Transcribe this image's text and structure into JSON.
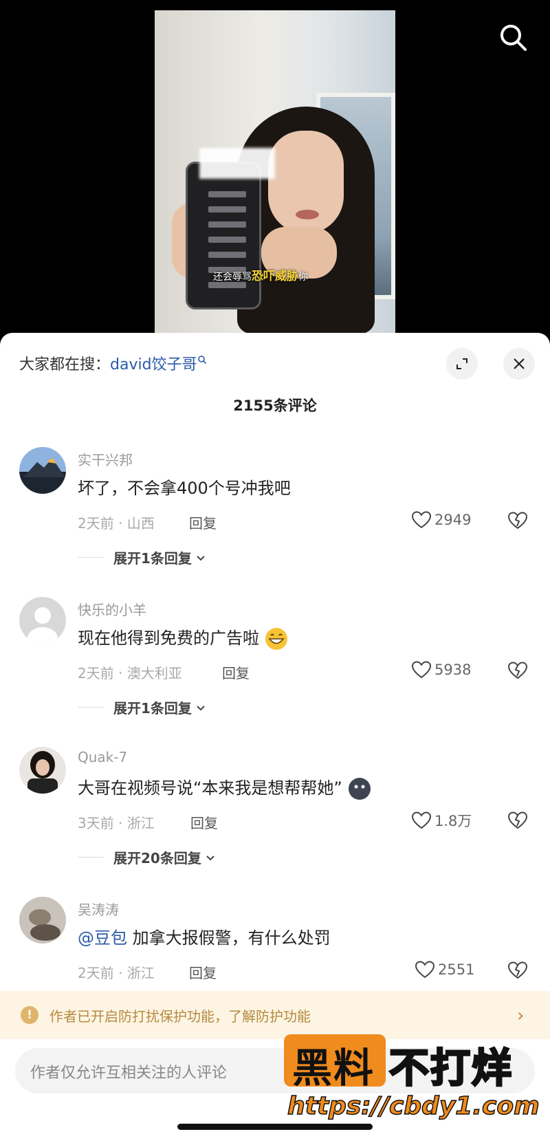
{
  "video": {
    "subtitle_pre": "还会辱骂",
    "subtitle_highlight": "恐吓威胁",
    "subtitle_post": "你"
  },
  "header": {
    "hot_search_prefix": "大家都在搜：",
    "hot_search_keyword": "david饺子哥",
    "comment_count": "2155条评论"
  },
  "comments": [
    {
      "user": "实干兴邦",
      "text": "坏了，不会拿400个号冲我吧",
      "time": "2天前 · 山西",
      "reply": "回复",
      "likes": "2949",
      "expand": "展开1条回复"
    },
    {
      "user": "快乐的小羊",
      "text": "现在他得到免费的广告啦",
      "time": "2天前 · 澳大利亚",
      "reply": "回复",
      "likes": "5938",
      "expand": "展开1条回复"
    },
    {
      "user": "Quak-7",
      "text": "大哥在视频号说“本来我是想帮帮她”",
      "time": "3天前 · 浙江",
      "reply": "回复",
      "likes": "1.8万",
      "expand": "展开20条回复"
    },
    {
      "user": "吴涛涛",
      "mention": "@豆包",
      "text": " 加拿大报假警，有什么处罚",
      "time": "2天前 · 浙江",
      "reply": "回复",
      "likes": "2551"
    }
  ],
  "notice": {
    "text": "作者已开启防打扰保护功能，了解防护功能"
  },
  "input": {
    "placeholder": "作者仅允许互相关注的人评论"
  },
  "watermark": {
    "title_a": "黑料",
    "title_b": "不打烊",
    "url": "https://cbdy1.com"
  },
  "colors": {
    "link": "#2b5aa8",
    "notice_bg": "#fdf4e3",
    "notice_text": "#b58a3f",
    "watermark": "#f08b1d"
  }
}
